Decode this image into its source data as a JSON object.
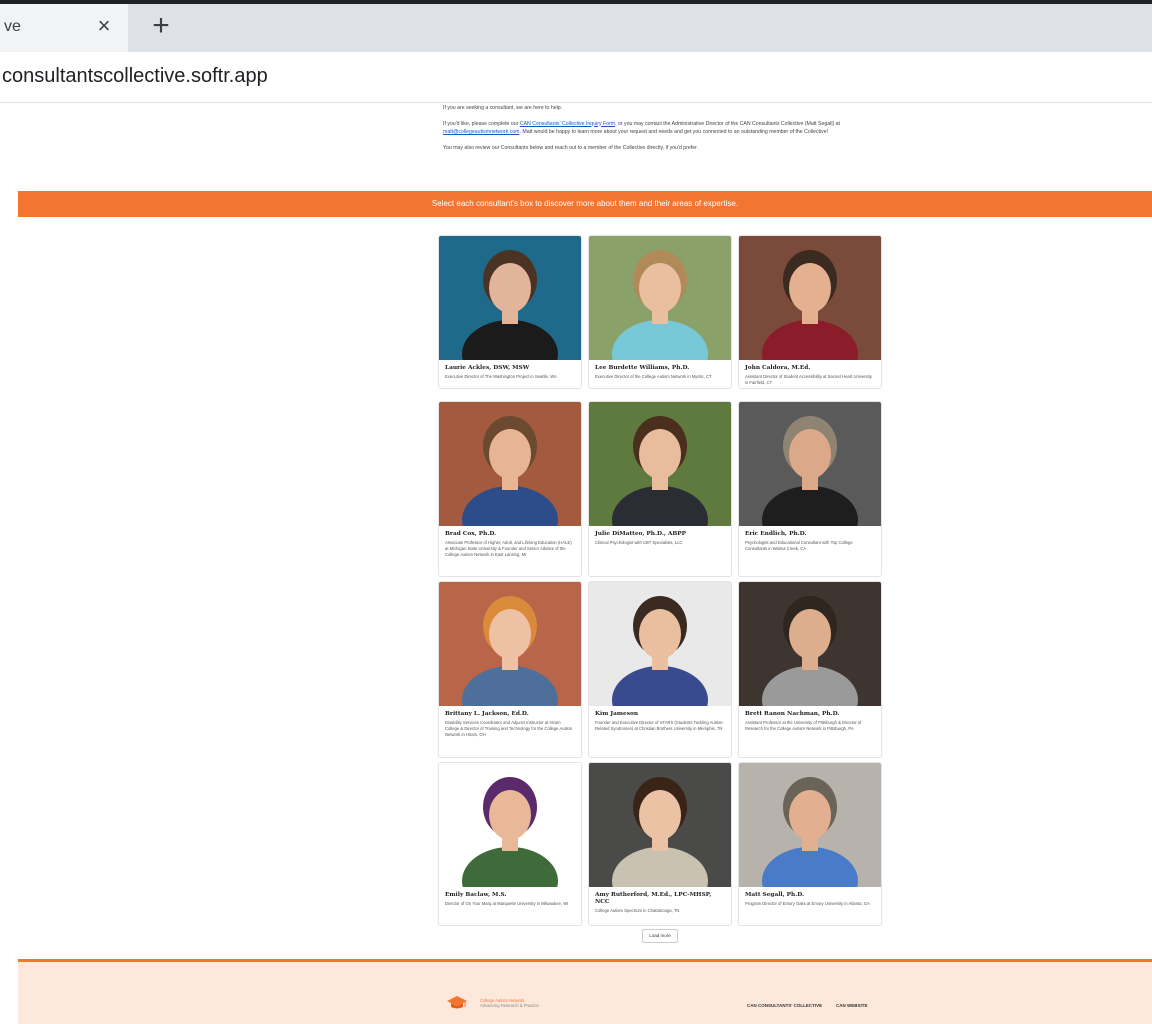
{
  "browser": {
    "tab_title": "ve",
    "close_glyph": "×",
    "newtab_glyph": "+",
    "url": "consultantscollective.softr.app"
  },
  "intro": {
    "p1": "If you are seeking a consultant, we are here to help.",
    "p2_before": "If you'd like, please complete our ",
    "p2_link1": "CAN Consultants' Collective Inquiry Form",
    "p2_middle": ", or you may contact the Administrative Director of the CAN Consultants Collective (Matt Segall) at ",
    "p2_link2": "matt@collegeautismnetwork.com",
    "p2_after": ". Matt would be happy to learn more about your request and needs and get you connected to an outstanding member of the Collective!",
    "p3": "You may also review our Consultants below and reach out to a member of the Collective directly, if you'd prefer."
  },
  "banner": "Select each consultant's box to discover more about them and their areas of expertise.",
  "consultants": [
    {
      "name": "Laurie Ackles, DSW, MSW",
      "desc": "Executive Director of The Washington Project in Seattle, WA",
      "bg": "#1f6a8a",
      "skin": "#e2b59a",
      "hair": "#4a3323",
      "shirt": "#1b1b1b"
    },
    {
      "name": "Lee Burdette Williams, Ph.D.",
      "desc": "Executive Director of the College Autism Network in Mystic, CT",
      "bg": "#8aa16a",
      "skin": "#eabf9f",
      "hair": "#b08a58",
      "shirt": "#78c9d8"
    },
    {
      "name": "John Caldora, M.Ed.",
      "desc": "Assistant Director of Student Accessibility at Sacred Heart University in Fairfield, CT",
      "bg": "#7a4a3a",
      "skin": "#e4b090",
      "hair": "#3b2a1f",
      "shirt": "#8b1c2a"
    },
    {
      "name": "Brad Cox, Ph.D.",
      "desc": "Associate Professor of Higher, Adult, and Lifelong Education (HALE) at Michigan State University & Founder and Senior Advisor of the College Autism Network in East Lansing, MI",
      "bg": "#a35a3e",
      "skin": "#e8b594",
      "hair": "#6b4a2f",
      "shirt": "#2d4d8a"
    },
    {
      "name": "Julie DiMatteo, Ph.D., ABPP",
      "desc": "Clinical Psychologist with CBT Specialists, LLC",
      "bg": "#5f7a3f",
      "skin": "#e8bc9c",
      "hair": "#4a2e1e",
      "shirt": "#2a2e34"
    },
    {
      "name": "Eric Endlich, Ph.D.",
      "desc": "Psychologist and Educational Consultant with Top College Consultants in Walnut Creek, CA",
      "bg": "#5a5a5a",
      "skin": "#dca88a",
      "hair": "#8f8472",
      "shirt": "#1e1e1e"
    },
    {
      "name": "Brittany L. Jackson, Ed.D.",
      "desc": "Disability Services Coordinator and Adjunct Instructor at Hiram College & Director of Training and Technology for the College Autism Network in Hiram, OH",
      "bg": "#b8654a",
      "skin": "#eec0a4",
      "hair": "#d98a3a",
      "shirt": "#4d6f9a"
    },
    {
      "name": "Kim Jameson",
      "desc": "Founder and Executive Director of STARS (Students Tackling Autism-Related Syndromes) at Christian Brothers University in Memphis, TN",
      "bg": "#e9e9e9",
      "skin": "#eabf9f",
      "hair": "#3b2a22",
      "shirt": "#3a4a8f"
    },
    {
      "name": "Brett Ranon Nachman, Ph.D.",
      "desc": "Assistant Professor at the University of Pittsburgh & Director of Research for the College Autism Network in Pittsburgh, PA",
      "bg": "#3f3530",
      "skin": "#dcae8e",
      "hair": "#2f2620",
      "shirt": "#9a9a9a"
    },
    {
      "name": "Emily Baclaw, M.S.",
      "desc": "Director of On Your Marq at Marquette University in Milwaukee, WI",
      "bg": "#ffffff",
      "skin": "#e9b898",
      "hair": "#5b2a6a",
      "shirt": "#3f6a3a"
    },
    {
      "name": "Amy Rutherford, M.Ed., LPC-MHSP, NCC",
      "desc": "College Autism Spectrum in Chattanooga, TN",
      "bg": "#4a4a48",
      "skin": "#ecc2a4",
      "hair": "#3a2418",
      "shirt": "#c9c2b0"
    },
    {
      "name": "Matt Segall, Ph.D.",
      "desc": "Program Director of Emory Oaks at Emory University in Atlanta, GA",
      "bg": "#b7b2ac",
      "skin": "#e2b091",
      "hair": "#6a6358",
      "shirt": "#4a7bc8"
    }
  ],
  "load_more": "Load more",
  "footer": {
    "logo_line1": "College Autism Network",
    "logo_line2": "Advancing Research & Practice",
    "link1": "CAN CONSULTANTS' COLLECTIVE",
    "link2": "CAN WEBSITE"
  },
  "colors": {
    "accent": "#f47530",
    "footer_bg": "#fde9dc"
  }
}
